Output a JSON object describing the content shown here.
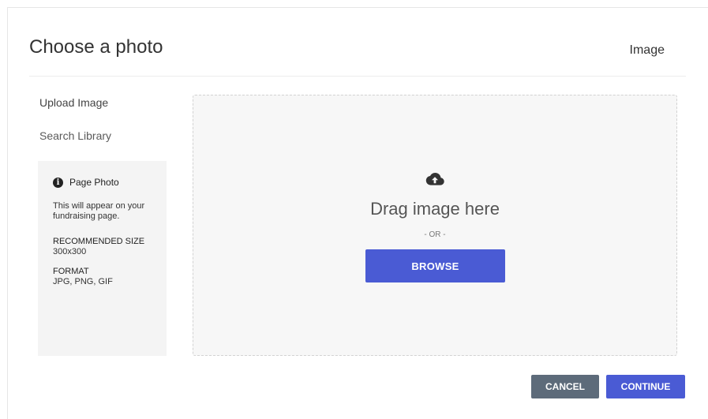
{
  "header": {
    "title": "Choose a photo",
    "right_label": "Image"
  },
  "nav": {
    "items": [
      {
        "label": "Upload Image"
      },
      {
        "label": "Search Library"
      }
    ]
  },
  "info": {
    "icon": "info-icon",
    "title": "Page Photo",
    "description": "This will appear on your fundraising page.",
    "size_label": "RECOMMENDED SIZE",
    "size_value": "300x300",
    "format_label": "FORMAT",
    "format_value": "JPG, PNG, GIF"
  },
  "dropzone": {
    "icon": "cloud-upload-icon",
    "drag_text": "Drag image here",
    "or_text": "- OR -",
    "browse_label": "BROWSE"
  },
  "footer": {
    "cancel_label": "CANCEL",
    "continue_label": "CONTINUE"
  },
  "colors": {
    "primary": "#4a5bd4",
    "secondary": "#5d6b7a",
    "panel": "#f4f4f4"
  }
}
